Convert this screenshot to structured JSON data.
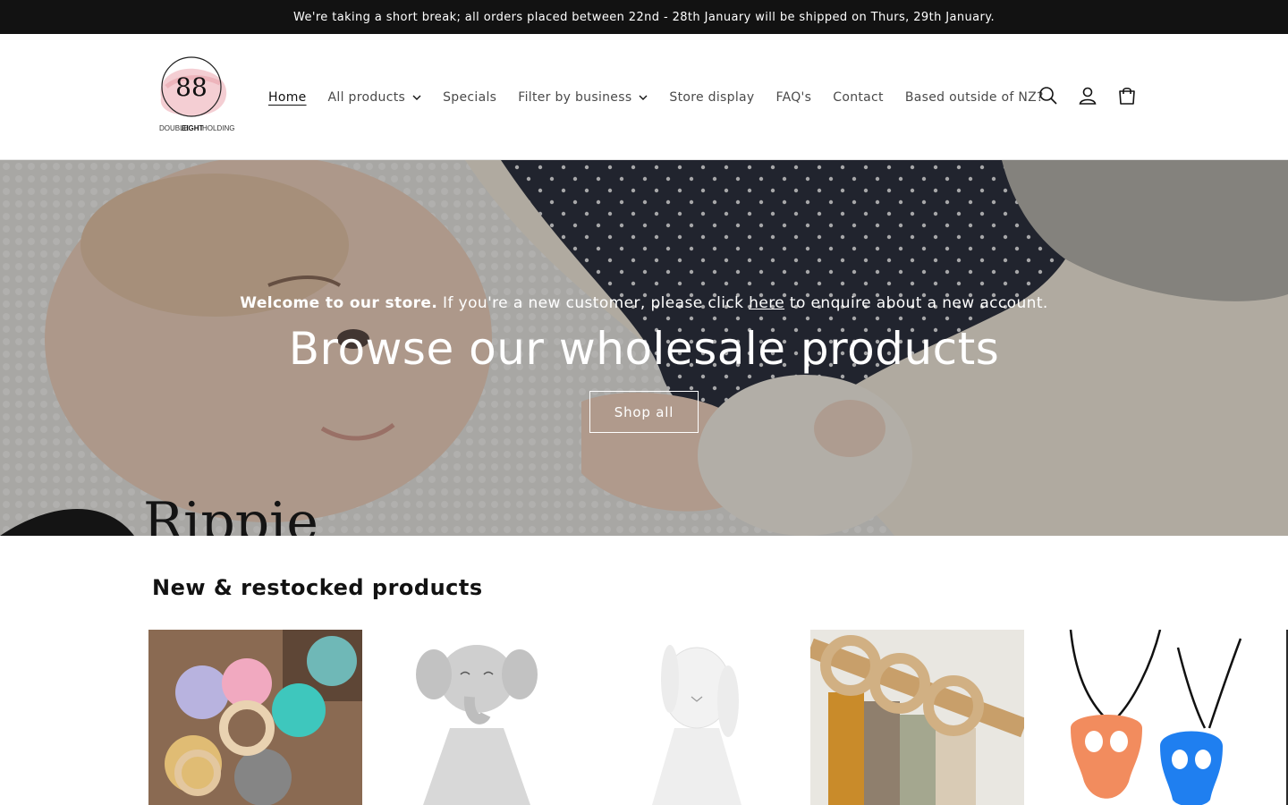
{
  "announcement": {
    "text": "We're taking a short break; all orders placed between 22nd - 28th January will be shipped on Thurs, 29th January."
  },
  "logo": {
    "number": "88",
    "line1": "DOUBLE",
    "line2": "EIGHT",
    "line3": "HOLDINGS",
    "icon": "brand-logo"
  },
  "nav": {
    "items": [
      {
        "label": "Home",
        "active": true
      },
      {
        "label": "All products",
        "dropdown": true
      },
      {
        "label": "Specials"
      },
      {
        "label": "Filter by business",
        "dropdown": true
      },
      {
        "label": "Store display"
      },
      {
        "label": "FAQ's"
      },
      {
        "label": "Contact"
      },
      {
        "label": "Based outside of NZ?"
      }
    ]
  },
  "header_icons": {
    "search": "search-icon",
    "account": "account-icon",
    "cart": "cart-icon"
  },
  "hero": {
    "sub_bold": "Welcome to our store.",
    "sub_before_link": " If you're a new customer, please click ",
    "sub_link": "here",
    "sub_after_link": " to enquire about a new account.",
    "title": "Browse our wholesale products",
    "button": "Shop all",
    "background_text": "Rippie"
  },
  "section": {
    "title": "New & restocked products"
  },
  "products": [
    {
      "image": "silicone-animal-teethers-photo"
    },
    {
      "image": "grey-elephant-comforter-photo"
    },
    {
      "image": "white-bunny-comforter-photo"
    },
    {
      "image": "wooden-teether-rings-photo"
    },
    {
      "image": "skull-chew-necklaces-photo"
    }
  ],
  "colors": {
    "announcement_bg": "#121212",
    "text": "#121212",
    "nav_text": "#4a4a4a"
  }
}
